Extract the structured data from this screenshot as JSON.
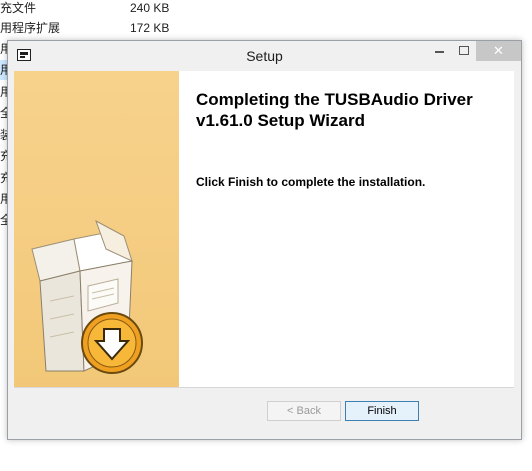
{
  "background_files": [
    {
      "name": "充文件",
      "size": "240 KB"
    },
    {
      "name": "用程序扩展",
      "size": "172 KB"
    }
  ],
  "background_fragments": [
    "用",
    "用",
    "用",
    "全",
    "装",
    "充",
    "充",
    "用",
    "全"
  ],
  "window": {
    "title": "Setup",
    "close_glyph": "✕",
    "heading": "Completing the TUSBAudio Driver v1.61.0 Setup Wizard",
    "body": "Click Finish to complete the installation.",
    "buttons": {
      "back": "< Back",
      "finish": "Finish"
    }
  },
  "colors": {
    "side_panel": "#f5cd83",
    "badge": "#f0a020",
    "close_button": "#c7c7c7"
  },
  "icons": [
    "setup-app-icon",
    "software-box-icon",
    "down-arrow-badge-icon"
  ]
}
